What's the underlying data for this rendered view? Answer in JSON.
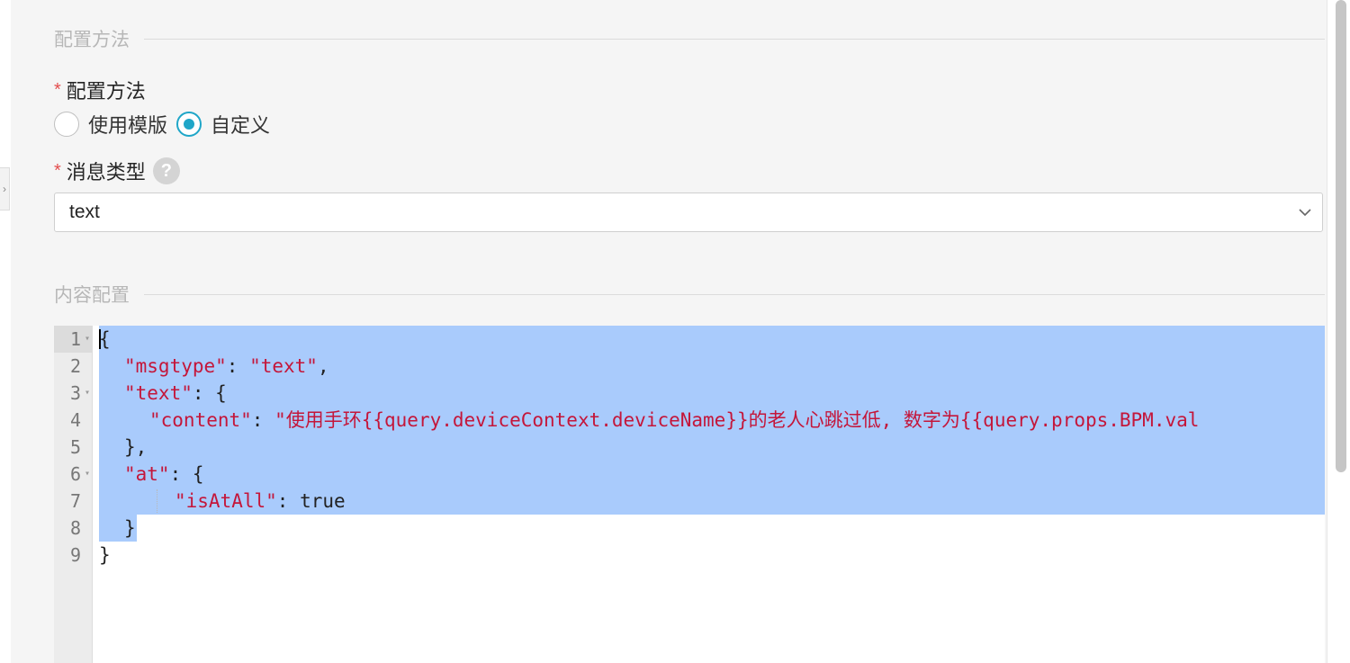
{
  "sections": {
    "config_method_header": "配置方法",
    "content_config_header": "内容配置"
  },
  "config_method": {
    "required_mark": "*",
    "label": "配置方法",
    "options": [
      {
        "label": "使用模版",
        "checked": false
      },
      {
        "label": "自定义",
        "checked": true
      }
    ]
  },
  "message_type": {
    "required_mark": "*",
    "label": "消息类型",
    "help_icon": "?",
    "selected_value": "text"
  },
  "editor": {
    "line_numbers": [
      "1",
      "2",
      "3",
      "4",
      "5",
      "6",
      "7",
      "8",
      "9"
    ],
    "lines": {
      "l1": "{",
      "l2_key": "\"msgtype\"",
      "l2_colon": ": ",
      "l2_val": "\"text\"",
      "l2_end": ",",
      "l3_key": "\"text\"",
      "l3_end": ": {",
      "l4_key": "\"content\"",
      "l4_colon": ": ",
      "l4_val": "\"使用手环{{query.deviceContext.deviceName}}的老人心跳过低, 数字为{{query.props.BPM.val",
      "l5": "},",
      "l6_key": "\"at\"",
      "l6_end": ": {",
      "l7_key": "\"isAtAll\"",
      "l7_colon": ": ",
      "l7_val": "true",
      "l8": "}",
      "l9": "}"
    }
  },
  "colors": {
    "accent": "#1fa6c8",
    "required": "#e34d4d",
    "string": "#c4163a",
    "selection": "#a9cbfc"
  },
  "icons": {
    "collapse": "chevron-right-icon",
    "help": "question-circle-icon",
    "dropdown": "chevron-down-icon"
  }
}
